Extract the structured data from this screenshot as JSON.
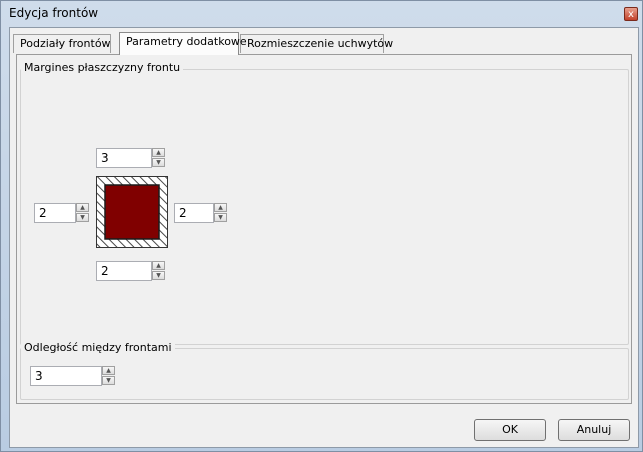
{
  "window": {
    "title": "Edycja frontów",
    "close_glyph": "x"
  },
  "tabs": [
    {
      "label": "Podziały frontów"
    },
    {
      "label": "Parametry dodatkowe"
    },
    {
      "label": "Rozmieszczenie uchwytów"
    }
  ],
  "margins_group": {
    "label": "Margines płaszczyzny frontu",
    "top": "3",
    "left": "2",
    "right": "2",
    "bottom": "2"
  },
  "spacing_group": {
    "label": "Odległość między frontami",
    "value": "3"
  },
  "buttons": {
    "ok": "OK",
    "cancel": "Anuluj"
  },
  "colors": {
    "front_fill": "#800000",
    "hatch": "#4a4a4a"
  },
  "glyphs": {
    "up": "▲",
    "down": "▼"
  }
}
